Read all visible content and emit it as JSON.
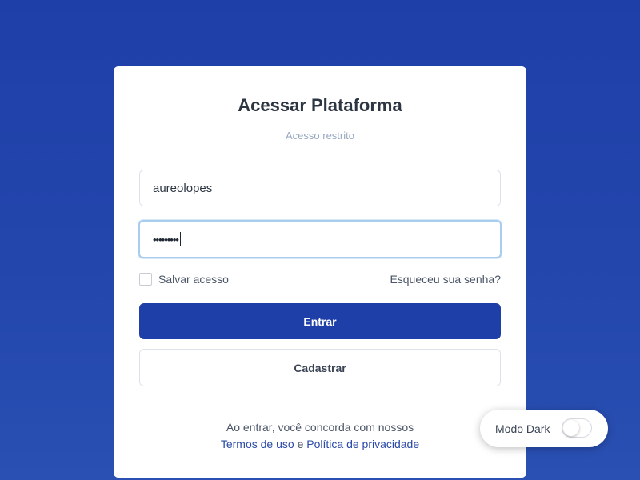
{
  "login": {
    "title": "Acessar Plataforma",
    "subtitle": "Acesso restrito",
    "username_value": "aureolopes",
    "password_masked": "•••••••••",
    "remember_label": "Salvar acesso",
    "remember_checked": false,
    "forgot_label": "Esqueceu sua senha?",
    "submit_label": "Entrar",
    "register_label": "Cadastrar",
    "terms_prefix": "Ao entrar, você concorda com nossos",
    "terms_link": "Termos de uso",
    "terms_and": " e ",
    "privacy_link": "Política de privacidade"
  },
  "dark_mode": {
    "label": "Modo Dark",
    "enabled": false
  },
  "colors": {
    "background": "#1e3fa8",
    "primary": "#1e3fa8",
    "card": "#ffffff",
    "focus_ring": "#a8cdee"
  }
}
